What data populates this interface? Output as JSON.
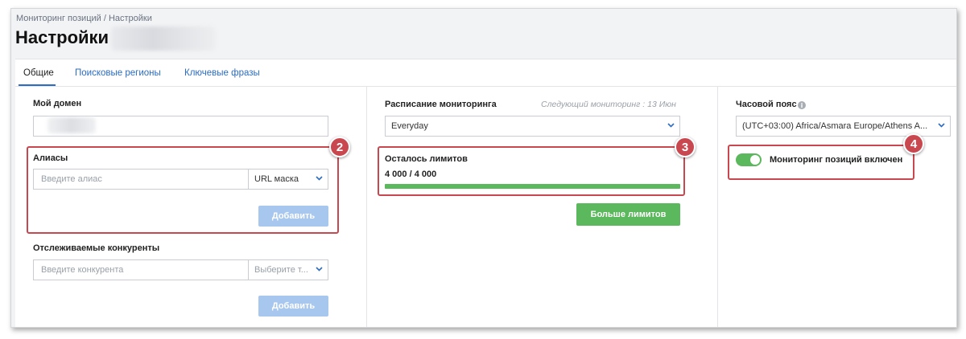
{
  "breadcrumb": "Мониторинг позиций / Настройки",
  "page_title": "Настройки",
  "tabs": [
    {
      "label": "Общие",
      "active": true
    },
    {
      "label": "Поисковые регионы",
      "active": false
    },
    {
      "label": "Ключевые фразы",
      "active": false
    }
  ],
  "domain": {
    "label": "Мой домен",
    "value": ""
  },
  "aliases": {
    "label": "Алиасы",
    "placeholder": "Введите алиас",
    "mask_select": "URL маска",
    "add_button": "Добавить"
  },
  "competitors": {
    "label": "Отслеживаемые конкуренты",
    "placeholder": "Введите конкурента",
    "type_select": "Выберите т...",
    "add_button": "Добавить"
  },
  "schedule": {
    "label": "Расписание мониторинга",
    "next_monitoring": "Следующий мониторинг : 13 Июн",
    "value": "Everyday"
  },
  "limits": {
    "label": "Осталось лимитов",
    "value_text": "4 000 / 4 000",
    "remaining": 4000,
    "total": 4000,
    "progress_fraction": 1.0,
    "more_button": "Больше лимитов"
  },
  "timezone": {
    "label": "Часовой пояс",
    "info_icon": "i",
    "value": "(UTC+03:00) Africa/Asmara Europe/Athens A..."
  },
  "monitoring_toggle": {
    "label": "Мониторинг позиций включен",
    "on": true
  },
  "badges": [
    "2",
    "3",
    "4"
  ],
  "colors": {
    "accent": "#2b6cc4",
    "success": "#5cb85c",
    "highlight": "#c9484f",
    "disabled_button": "#a8c7ee"
  }
}
